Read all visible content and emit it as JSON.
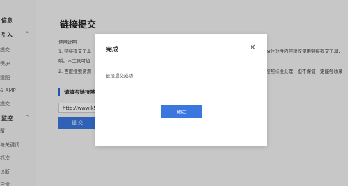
{
  "sidebar": {
    "items": [
      {
        "label": "信息",
        "section": true
      },
      {
        "label": "引入",
        "section": true,
        "chevron": "^"
      },
      {
        "label": "提交",
        "section": false
      },
      {
        "label": "保护",
        "section": false
      },
      {
        "label": "适配",
        "section": false
      },
      {
        "label": "& AMP",
        "section": false
      },
      {
        "label": "提交",
        "section": false
      },
      {
        "label": "监控",
        "section": true,
        "chevron": "^"
      },
      {
        "label": "覆",
        "section": false
      },
      {
        "label": "与关键词",
        "section": false
      },
      {
        "label": "抓次",
        "section": false
      },
      {
        "label": "诊断",
        "section": false
      },
      {
        "label": "异常",
        "section": false
      }
    ]
  },
  "main": {
    "page_title": "链接提交",
    "help_heading": "使用说明",
    "help_line1": "1. 链接提交工具",
    "help_line1_right": "站时效性内容建议使用链接提交工具，",
    "help_line2": "瞬。本工具可加",
    "help_line3": "2. 百度搜索资源",
    "help_line3_right": "按照标准处理，但不保证一定能够收录",
    "input_label": "请填写链接地",
    "url_value": "http://www.k51",
    "submit_label": "提 交"
  },
  "modal": {
    "title": "完成",
    "close_icon": "×",
    "message": "链接提交成功",
    "ok_label": "确定"
  },
  "colors": {
    "primary": "#3a78e0",
    "overlay": "rgba(0,0,0,0.18)"
  }
}
